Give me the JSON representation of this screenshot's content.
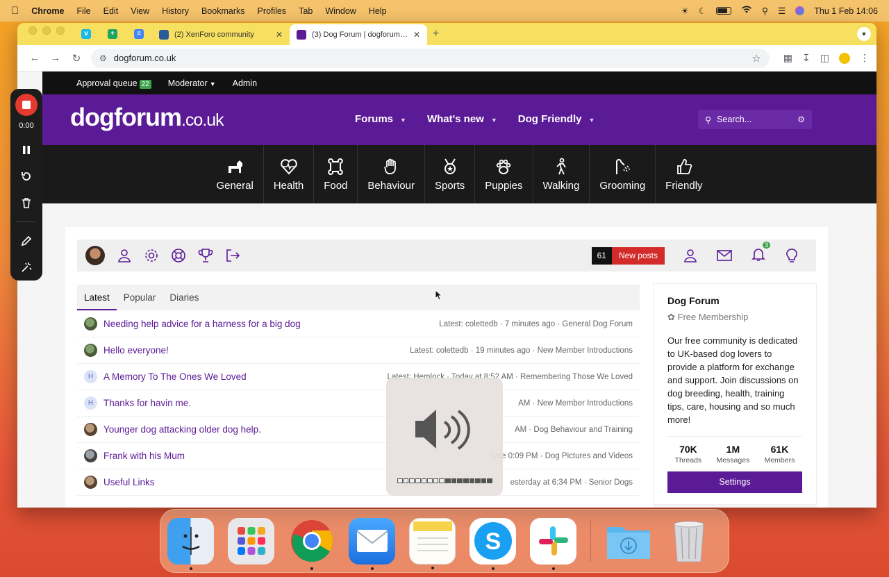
{
  "menubar": {
    "app": "Chrome",
    "items": [
      "File",
      "Edit",
      "View",
      "History",
      "Bookmarks",
      "Profiles",
      "Tab",
      "Window",
      "Help"
    ],
    "datetime": "Thu 1 Feb  14:06"
  },
  "browser": {
    "tabs": [
      {
        "title": "(2) XenForo community",
        "active": false
      },
      {
        "title": "(3) Dog Forum | dogforum.co",
        "active": true
      }
    ],
    "url": "dogforum.co.uk"
  },
  "staffbar": {
    "approval_label": "Approval queue",
    "approval_count": "22",
    "moderator": "Moderator",
    "admin": "Admin"
  },
  "header": {
    "logo_main": "dogforum",
    "logo_tld": ".co.uk",
    "nav": [
      "Forums",
      "What's new",
      "Dog Friendly"
    ],
    "search_placeholder": "Search..."
  },
  "categories": [
    "General",
    "Health",
    "Food",
    "Behaviour",
    "Sports",
    "Puppies",
    "Walking",
    "Grooming",
    "Friendly"
  ],
  "userbar": {
    "new_posts_count": "61",
    "new_posts_label": "New posts",
    "alerts_count": "3"
  },
  "feed_tabs": [
    "Latest",
    "Popular",
    "Diaries"
  ],
  "threads": [
    {
      "title": "Needing help advice for a harness for a big dog",
      "meta": "Latest: colettedb · 7 minutes ago  ·  General Dog Forum",
      "avatar": "img"
    },
    {
      "title": "Hello everyone!",
      "meta": "Latest: colettedb · 19 minutes ago  ·  New Member Introductions",
      "avatar": "img"
    },
    {
      "title": "A Memory To The Ones We Loved",
      "meta": "Latest: Hemlock · Today at 8:52 AM  ·  Remembering Those We Loved",
      "avatar": "H"
    },
    {
      "title": "Thanks for havin me.",
      "meta": "AM  ·  New Member Introductions",
      "avatar": "H"
    },
    {
      "title": "Younger dog attacking older dog help.",
      "meta": "AM  ·  Dog Behaviour and Training",
      "avatar": "img2"
    },
    {
      "title": "Frank with his Mum",
      "meta": "Late      0:09 PM  ·  Dog Pictures and Videos",
      "avatar": "img3"
    },
    {
      "title": "Useful Links",
      "meta": "esterday at 6:34 PM  ·  Senior Dogs",
      "avatar": "img2"
    }
  ],
  "sidebar": {
    "title": "Dog Forum",
    "subtitle": "Free Membership",
    "description": "Our free community is dedicated to UK-based dog lovers to provide a platform for exchange and support. Join discussions on dog breeding, health, training tips, care, housing and so much more!",
    "stats": [
      {
        "value": "70K",
        "label": "Threads"
      },
      {
        "value": "1M",
        "label": "Messages"
      },
      {
        "value": "61K",
        "label": "Members"
      }
    ],
    "button": "Settings"
  },
  "recorder": {
    "time": "0:00"
  },
  "volume": {
    "level": 0.5
  },
  "dock": [
    "Finder",
    "Launchpad",
    "Chrome",
    "Mail",
    "Notes",
    "Skype",
    "Slack",
    "Downloads",
    "Trash"
  ],
  "colors": {
    "brand": "#5b1a96",
    "alert": "#d32a2a",
    "green_badge": "#3fa34d"
  }
}
